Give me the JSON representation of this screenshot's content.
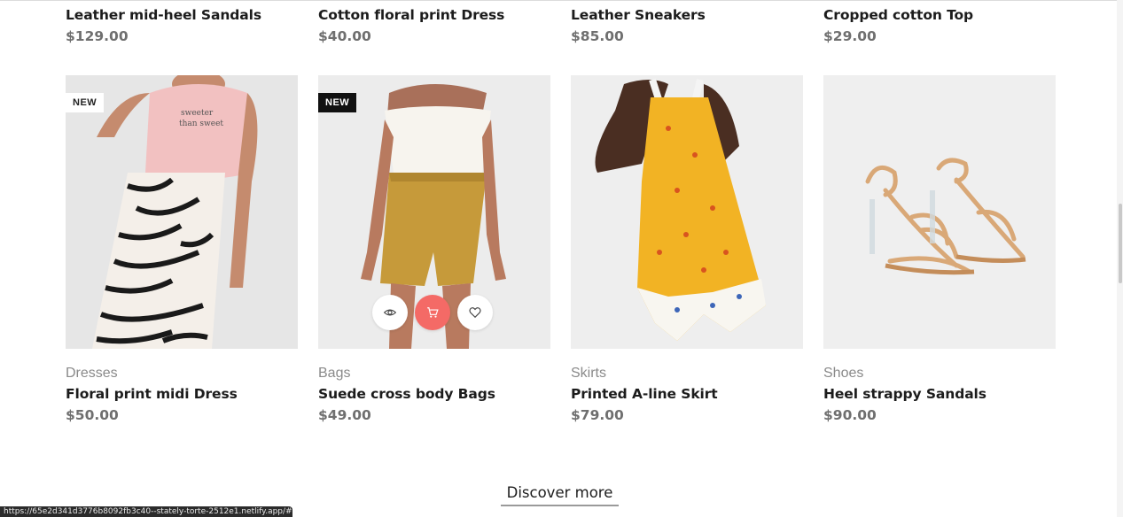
{
  "top_row": [
    {
      "name": "Leather mid-heel Sandals",
      "price": "$129.00"
    },
    {
      "name": "Cotton floral print Dress",
      "price": "$40.00"
    },
    {
      "name": "Leather Sneakers",
      "price": "$85.00"
    },
    {
      "name": "Cropped cotton Top",
      "price": "$29.00"
    }
  ],
  "products": [
    {
      "category": "Dresses",
      "name": "Floral print midi Dress",
      "price": "$50.00",
      "badge": "NEW"
    },
    {
      "category": "Bags",
      "name": "Suede cross body Bags",
      "price": "$49.00",
      "badge": "NEW"
    },
    {
      "category": "Skirts",
      "name": "Printed A-line Skirt",
      "price": "$79.00"
    },
    {
      "category": "Shoes",
      "name": "Heel strappy Sandals",
      "price": "$90.00"
    }
  ],
  "hover_actions": {
    "icons": [
      "eye-icon",
      "cart-icon",
      "heart-icon"
    ],
    "primary_color": "#f46a66"
  },
  "discover_label": "Discover more",
  "status_url": "https://65e2d341d3776b8092fb3c40--stately-torte-2512e1.netlify.app/#"
}
